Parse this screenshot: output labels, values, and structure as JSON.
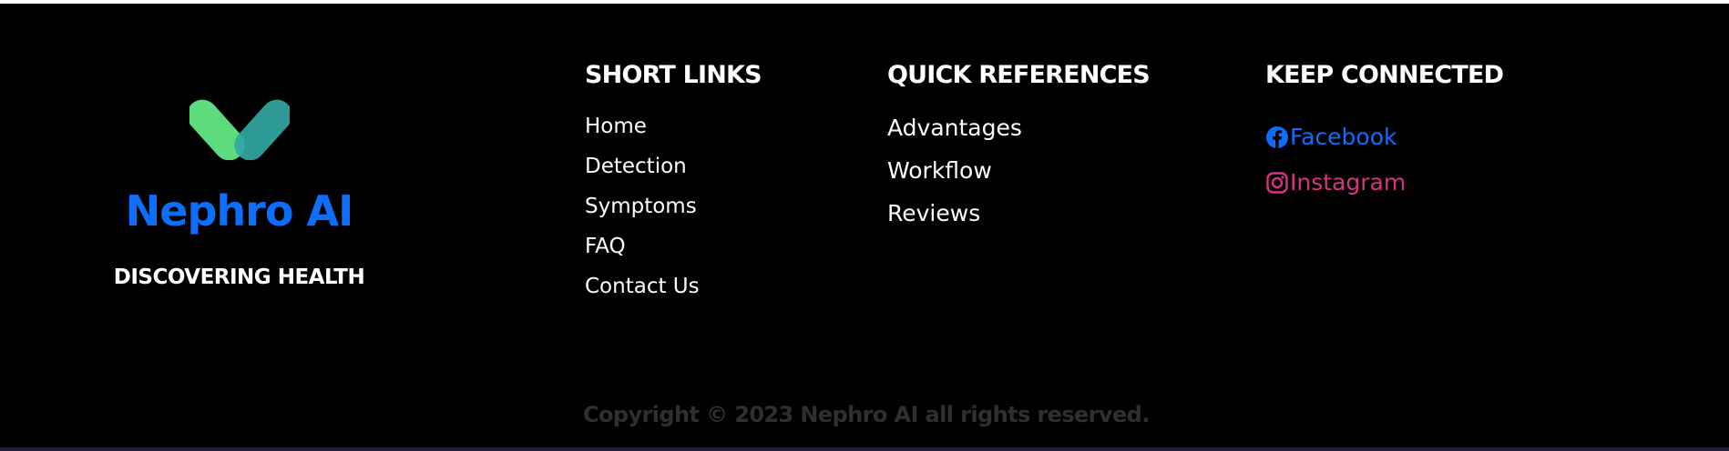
{
  "brand": {
    "name": "Nephro AI",
    "tagline": "DISCOVERING HEALTH",
    "name_color": "#0d6efd",
    "logo_icon": "heart-check-logo"
  },
  "short_links": {
    "title": "SHORT LINKS",
    "items": [
      "Home",
      "Detection",
      "Symptoms",
      "FAQ",
      "Contact Us"
    ]
  },
  "quick_references": {
    "title": "QUICK REFERENCES",
    "items": [
      "Advantages",
      "Workflow",
      "Reviews"
    ]
  },
  "keep_connected": {
    "title": "KEEP CONNECTED",
    "facebook": {
      "label": "Facebook",
      "icon": "facebook-icon",
      "color": "#0d6efd"
    },
    "instagram": {
      "label": "Instagram",
      "icon": "instagram-icon",
      "color": "#d63384"
    }
  },
  "copyright": "Copyright © 2023 Nephro AI all rights reserved.",
  "colors": {
    "background": "#000000",
    "text": "#ffffff",
    "copyright": "#2f2f2f"
  }
}
